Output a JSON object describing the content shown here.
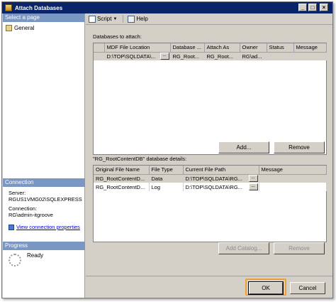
{
  "window": {
    "title": "Attach Databases"
  },
  "left_pane": {
    "select_page_label": "Select a page",
    "pages": [
      {
        "label": "General"
      }
    ],
    "connection": {
      "header": "Connection",
      "server_label": "Server:",
      "server_value": "RGUS1VMG02\\SQLEXPRESS",
      "connection_label": "Connection:",
      "connection_value": "RG\\admin-itgroove",
      "view_properties_link": "View connection properties"
    },
    "progress": {
      "header": "Progress",
      "status": "Ready"
    }
  },
  "toolbar": {
    "script_label": "Script",
    "help_label": "Help"
  },
  "attach_section": {
    "label": "Databases to attach:",
    "columns": [
      "MDF File Location",
      "Database ...",
      "Attach As",
      "Owner",
      "Status",
      "Message"
    ],
    "rows": [
      {
        "mdf": "D:\\TOP\\SQLDATA\\...",
        "database": "RG_Root...",
        "attach_as": "RG_Root...",
        "owner": "RG\\ad...",
        "status": "",
        "message": ""
      }
    ],
    "add_button": "Add...",
    "remove_button": "Remove"
  },
  "details_section": {
    "label": "\"RG_RootContentDB\" database details:",
    "columns": [
      "Original File Name",
      "File Type",
      "Current File Path",
      "Message"
    ],
    "rows": [
      {
        "name": "RG_RootContentD...",
        "type": "Data",
        "path": "D:\\TOP\\SQLDATA\\RG...",
        "message": ""
      },
      {
        "name": "RG_RootContentD...",
        "type": "Log",
        "path": "D:\\TOP\\SQLDATA\\RG...",
        "message": ""
      }
    ],
    "add_catalog_button": "Add Catalog...",
    "remove_button": "Remove"
  },
  "footer": {
    "ok_button": "OK",
    "cancel_button": "Cancel"
  },
  "colors": {
    "title_bar": "#0a246a",
    "pane_header": "#7a96c2",
    "face": "#d4d0c8",
    "highlight": "#f0a030"
  }
}
